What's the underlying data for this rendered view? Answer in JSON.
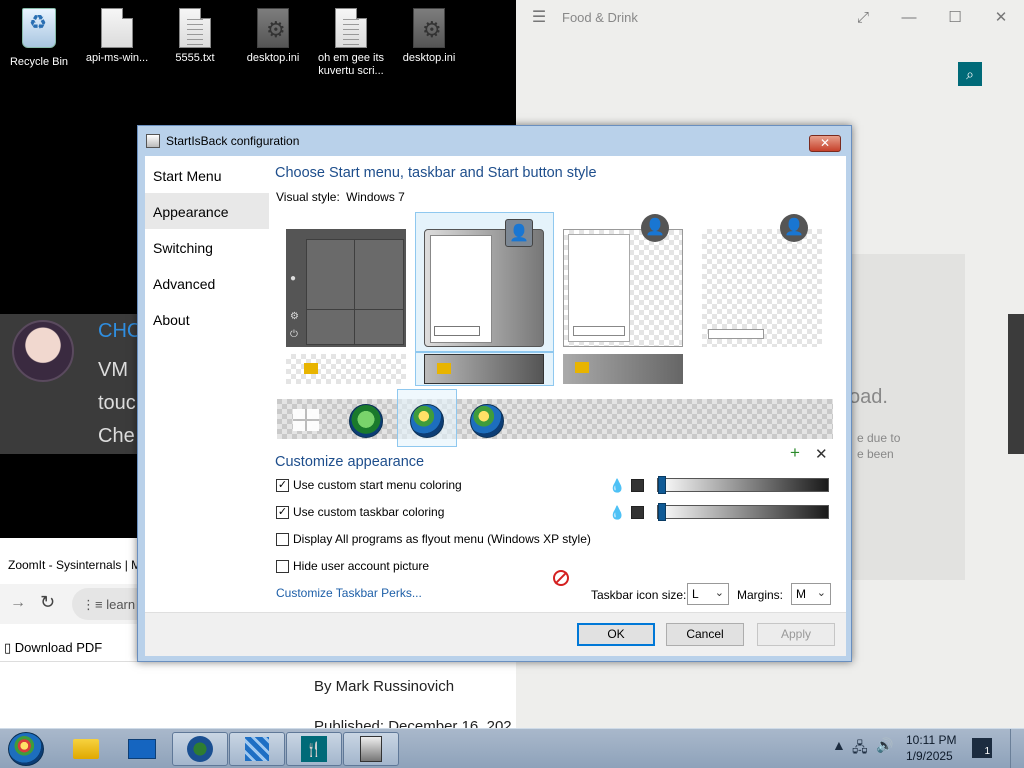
{
  "desktop": {
    "icons": [
      {
        "label": "Recycle Bin",
        "icon": "recycle-bin-icon"
      },
      {
        "label": "api-ms-win...",
        "icon": "gear-file-icon"
      },
      {
        "label": "5555.txt",
        "icon": "text-file-icon"
      },
      {
        "label": "desktop.ini",
        "icon": "gear-file-icon"
      },
      {
        "label": "oh em gee its kuvertu scri...",
        "icon": "text-file-icon"
      },
      {
        "label": "desktop.ini",
        "icon": "gear-file-icon"
      }
    ]
  },
  "food_drink": {
    "title": "Food & Drink",
    "body_fragment_1": "oad.",
    "body_fragment_2": "e due to\ne been"
  },
  "toast": {
    "title_fragment": "CHC",
    "lines": [
      "VM",
      "touc",
      "Che"
    ]
  },
  "browser": {
    "tab_title": "ZoomIt - Sysinternals | M",
    "address_fragment": "learn",
    "download_pdf": "Download PDF",
    "author": "By Mark Russinovich",
    "published": "Published: December 16, 202"
  },
  "dialog": {
    "title": "StartIsBack configuration",
    "close_label": "✕",
    "nav": [
      "Start Menu",
      "Appearance",
      "Switching",
      "Advanced",
      "About"
    ],
    "active_nav": "Appearance",
    "heading_style": "Choose Start menu, taskbar and Start button style",
    "visual_style_label": "Visual style:",
    "visual_style_value": "Windows 7",
    "heading_customize": "Customize appearance",
    "add_icon": "+",
    "remove_icon": "✕",
    "options": [
      {
        "label": "Use custom start menu coloring",
        "checked": true
      },
      {
        "label": "Use custom taskbar coloring",
        "checked": true
      },
      {
        "label": "Display All programs as flyout menu (Windows XP style)",
        "checked": false
      },
      {
        "label": "Hide user account picture",
        "checked": false
      }
    ],
    "customize_link": "Customize Taskbar Perks...",
    "icon_size_label": "Taskbar icon size:",
    "icon_size_value": "L",
    "margins_label": "Margins:",
    "margins_value": "M",
    "buttons": {
      "ok": "OK",
      "cancel": "Cancel",
      "apply": "Apply"
    }
  },
  "taskbar": {
    "clock_time": "10:11 PM",
    "clock_date": "1/9/2025",
    "notification_count": "1"
  }
}
